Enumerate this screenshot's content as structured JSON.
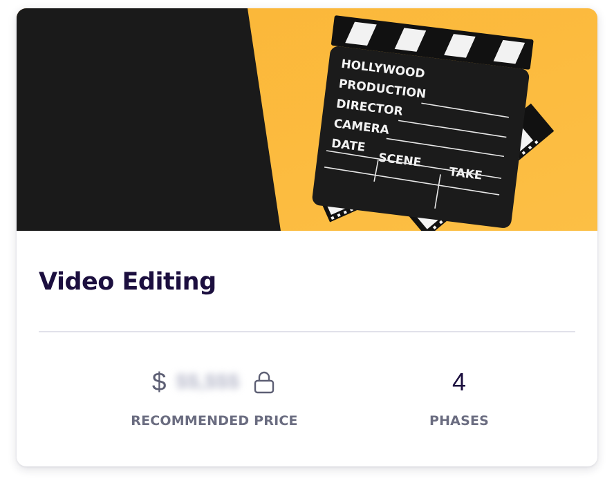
{
  "card": {
    "image_alt": "Film clapperboard with film strips on a yellow and black background",
    "clapperboard": {
      "line1": "HOLLYWOOD",
      "line2": "PRODUCTION",
      "line3": "DIRECTOR",
      "line4": "CAMERA",
      "date": "DATE",
      "scene": "SCENE",
      "take": "TAKE"
    },
    "title": "Video Editing",
    "price": {
      "currency": "$",
      "value": "$$,$$$",
      "label": "RECOMMENDED PRICE",
      "icon": "lock-icon"
    },
    "phases": {
      "value": "4",
      "label": "PHASES"
    }
  },
  "colors": {
    "title": "#1c0f3f",
    "label": "#6a6c80",
    "hero_yellow": "#fbb73a",
    "hero_dark": "#1a1a1a",
    "divider": "#e1e1ea"
  }
}
